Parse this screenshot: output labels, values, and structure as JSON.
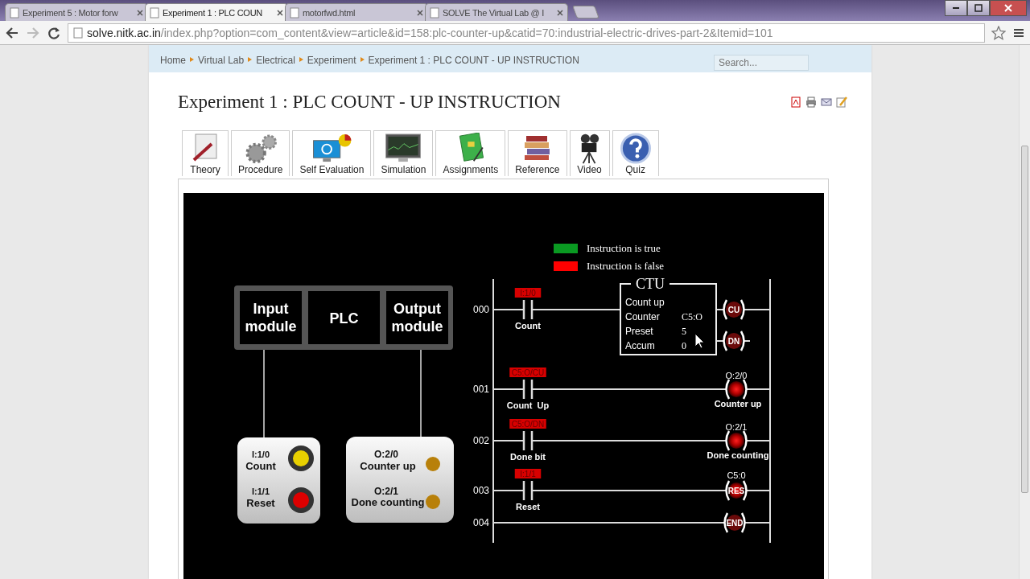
{
  "browser": {
    "tabs": [
      {
        "title": "Experiment 5 : Motor forw",
        "selected": false
      },
      {
        "title": "Experiment 1 : PLC COUN",
        "selected": true
      },
      {
        "title": "motorfwd.html",
        "selected": false
      },
      {
        "title": "SOLVE The Virtual Lab @ I",
        "selected": false
      }
    ],
    "url_host": "solve.nitk.ac.in",
    "url_rest": "/index.php?option=com_content&view=article&id=158:plc-counter-up&catid=70:industrial-electric-drives-part-2&Itemid=101"
  },
  "breadcrumb": [
    "Home",
    "Virtual Lab",
    "Electrical",
    "Experiment",
    "Experiment 1 : PLC COUNT - UP INSTRUCTION"
  ],
  "search": {
    "placeholder": "Search..."
  },
  "title": "Experiment 1 : PLC COUNT - UP INSTRUCTION",
  "nav_tabs": [
    "Theory",
    "Procedure",
    "Self Evaluation",
    "Simulation",
    "Assignments",
    "Reference",
    "Video",
    "Quiz"
  ],
  "simulation": {
    "legend": [
      {
        "label": "Instruction is true",
        "color": "#0a9a22"
      },
      {
        "label": "Instruction is false",
        "color": "#ff0000"
      }
    ],
    "plc_modules": [
      [
        "Input",
        "module"
      ],
      [
        "PLC"
      ],
      [
        "Output",
        "module"
      ]
    ],
    "inputs": [
      {
        "address": "I:1/0",
        "label": "Count",
        "color": "#e8d000"
      },
      {
        "address": "I:1/1",
        "label": "Reset",
        "color": "#dd0000"
      }
    ],
    "outputs": [
      {
        "address": "O:2/0",
        "label": "Counter up",
        "color": "#b8800a"
      },
      {
        "address": "O:2/1",
        "label": "Done counting",
        "color": "#b8800a"
      }
    ],
    "rungs": [
      {
        "number": "000",
        "contact_tag": "I:1/0",
        "contact_label": "Count",
        "true": false,
        "kind": "counter",
        "counter": {
          "title": "CTU",
          "rows": [
            [
              "Count up"
            ],
            [
              "Counter",
              "C5:O"
            ],
            [
              "Preset",
              "5"
            ],
            [
              "Accum",
              "0"
            ]
          ],
          "coils": [
            "CU",
            "DN"
          ]
        }
      },
      {
        "number": "001",
        "contact_tag": "C5:O/CU",
        "contact_label": "Count  Up",
        "true": false,
        "kind": "coil",
        "coil_address": "O:2/0",
        "coil_label": "Counter up"
      },
      {
        "number": "002",
        "contact_tag": "C5:O/DN",
        "contact_label": "Done bit",
        "true": false,
        "kind": "coil",
        "coil_address": "O:2/1",
        "coil_label": "Done counting"
      },
      {
        "number": "003",
        "contact_tag": "I:1/1",
        "contact_label": "Reset",
        "true": false,
        "kind": "reset",
        "coil_address": "C5:0",
        "coil_text": "RES"
      },
      {
        "number": "004",
        "kind": "end",
        "coil_text": "END"
      }
    ]
  }
}
